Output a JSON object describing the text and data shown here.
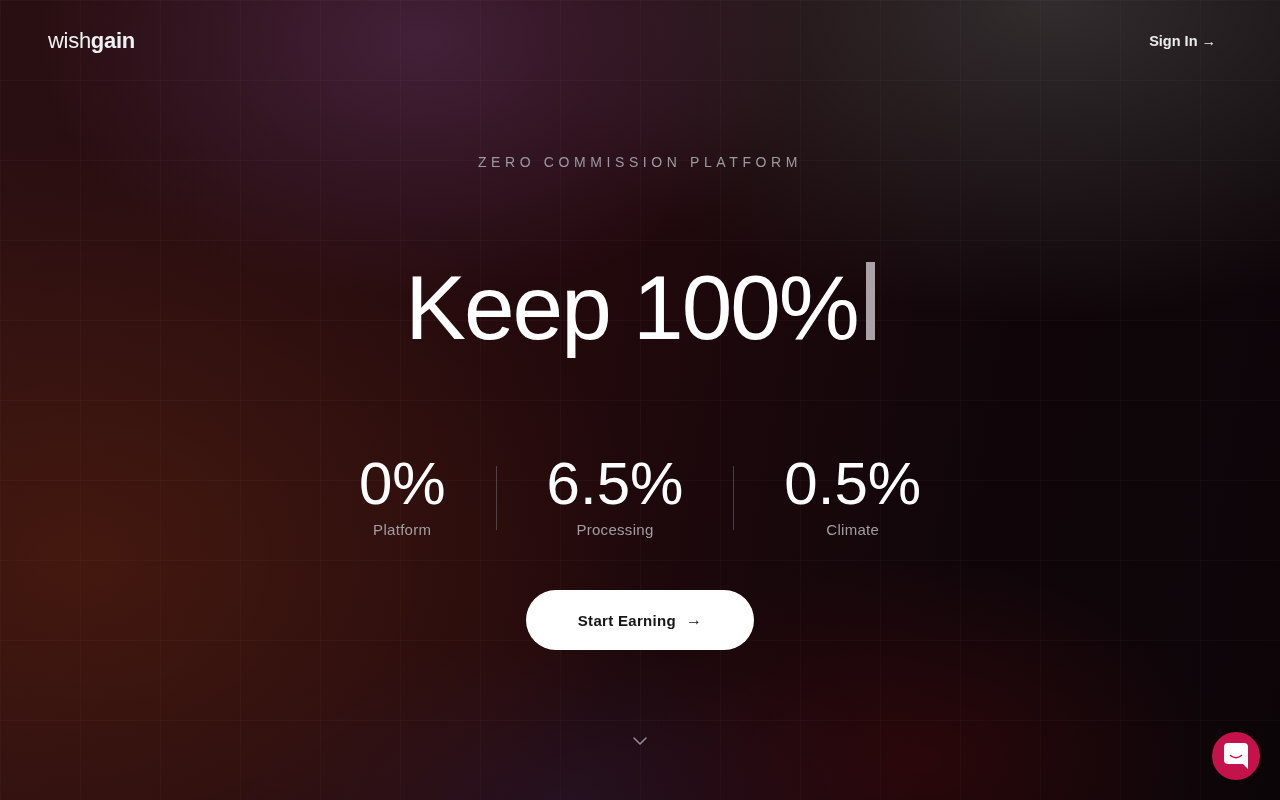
{
  "nav": {
    "logo": "wish**gain**",
    "sign_in": {
      "label": "Sign In",
      "arrow": "→"
    }
  },
  "hero": {
    "eyebrow": "ZERO COMMISSION PLATFORM",
    "headline": "Keep 100%",
    "stats": [
      {
        "value": "0%",
        "label": "Platform"
      },
      {
        "value": "6.5%",
        "label": "Processing"
      },
      {
        "value": "0.5%",
        "label": "Climate"
      }
    ],
    "cta": {
      "label": "Start Earning",
      "arrow": "→"
    }
  }
}
